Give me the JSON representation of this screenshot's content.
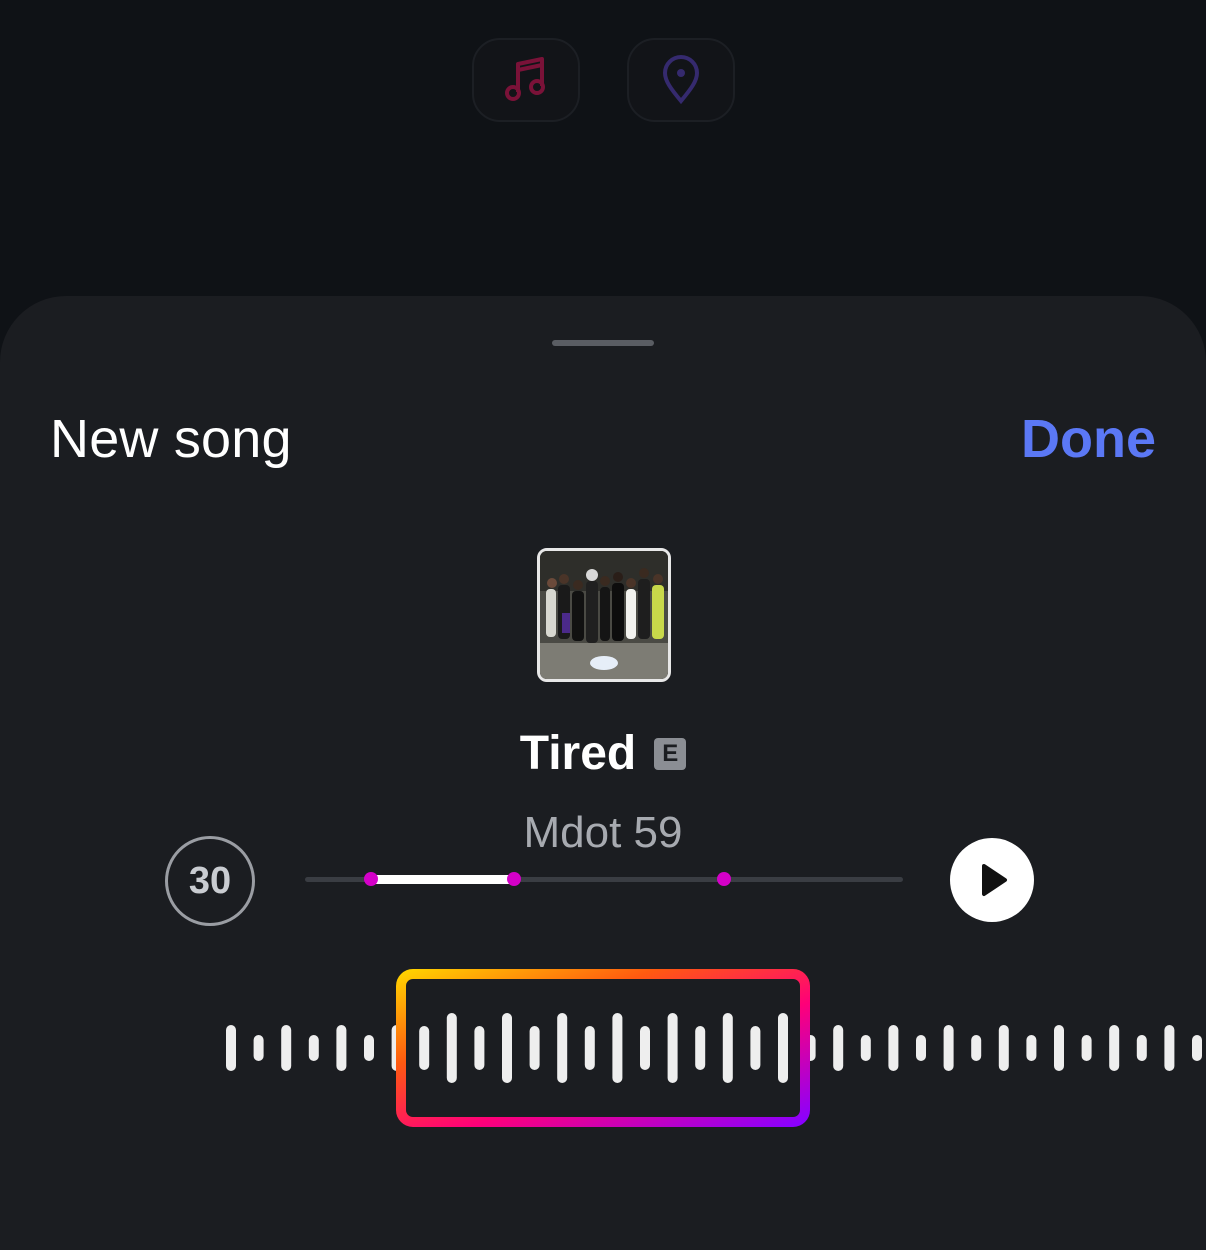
{
  "sheet": {
    "title": "New song",
    "done_label": "Done"
  },
  "song": {
    "title": "Tired",
    "explicit_label": "E",
    "artist": "Mdot 59"
  },
  "controls": {
    "duration_label": "30"
  },
  "icons": {
    "music": "music-note-icon",
    "location": "location-pin-icon",
    "play": "play-icon"
  },
  "colors": {
    "accent": "#5b78f5",
    "music_icon": "#8a1040",
    "location_icon": "#3a2e7a",
    "progress_dot": "#d400c8"
  },
  "progress": {
    "played_fraction_start": 0.11,
    "played_fraction_end": 0.35,
    "marker_fraction": 0.7
  }
}
